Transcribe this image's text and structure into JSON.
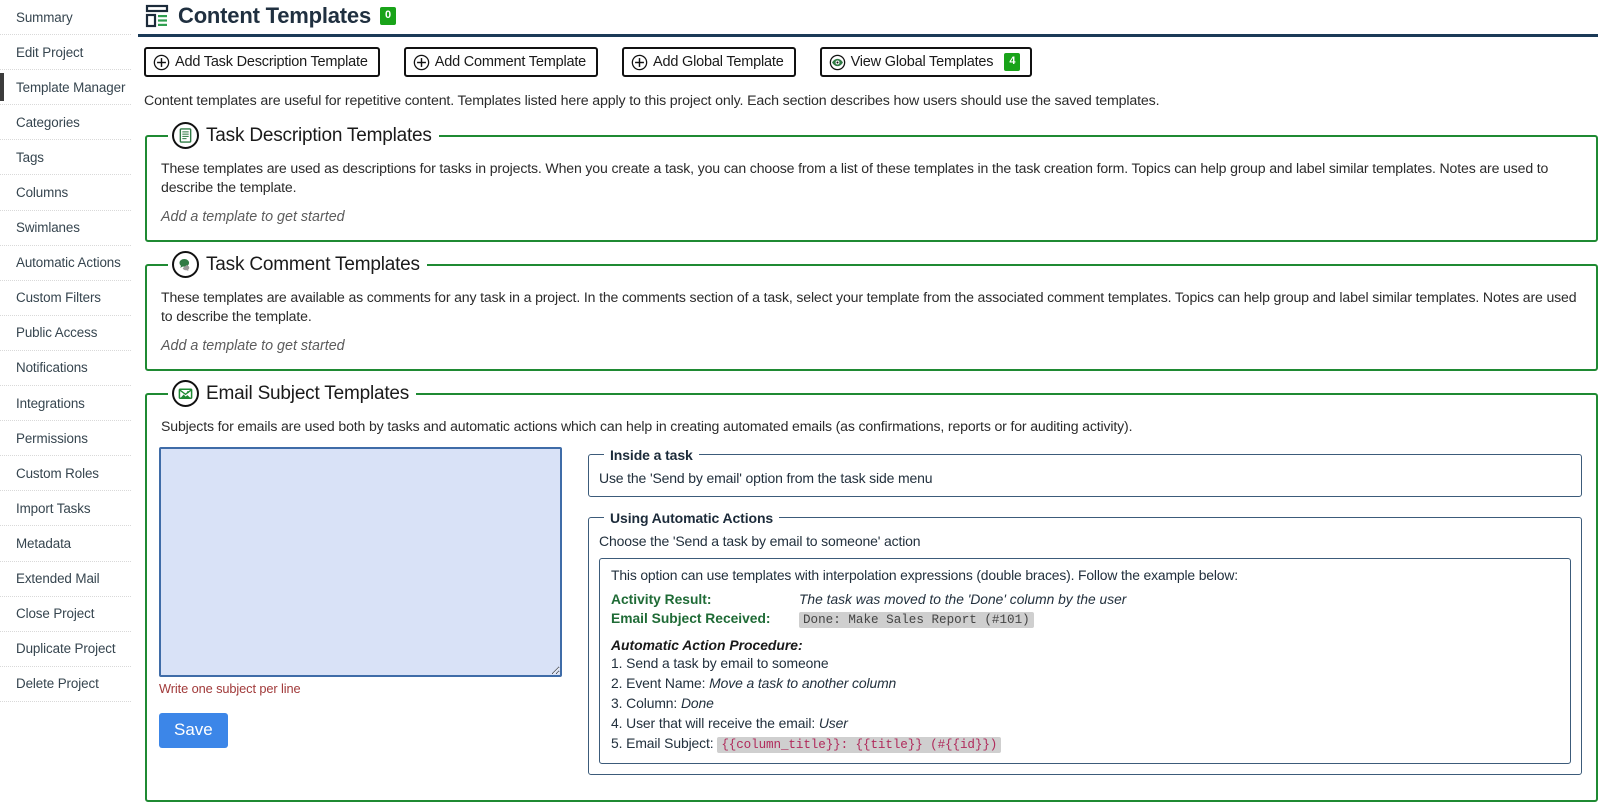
{
  "sidebar": {
    "items": [
      {
        "label": "Summary",
        "active": false
      },
      {
        "label": "Edit Project",
        "active": false
      },
      {
        "label": "Template Manager",
        "active": true
      },
      {
        "label": "Categories",
        "active": false
      },
      {
        "label": "Tags",
        "active": false
      },
      {
        "label": "Columns",
        "active": false
      },
      {
        "label": "Swimlanes",
        "active": false
      },
      {
        "label": "Automatic Actions",
        "active": false
      },
      {
        "label": "Custom Filters",
        "active": false
      },
      {
        "label": "Public Access",
        "active": false
      },
      {
        "label": "Notifications",
        "active": false
      },
      {
        "label": "Integrations",
        "active": false
      },
      {
        "label": "Permissions",
        "active": false
      },
      {
        "label": "Custom Roles",
        "active": false
      },
      {
        "label": "Import Tasks",
        "active": false
      },
      {
        "label": "Metadata",
        "active": false
      },
      {
        "label": "Extended Mail",
        "active": false
      },
      {
        "label": "Close Project",
        "active": false
      },
      {
        "label": "Duplicate Project",
        "active": false
      },
      {
        "label": "Delete Project",
        "active": false
      }
    ]
  },
  "header": {
    "title": "Content Templates",
    "badge": "0",
    "icon": "content-templates-icon",
    "accent_color": "#1b3a57",
    "badge_color": "#19a319"
  },
  "toolbar": {
    "buttons": [
      {
        "label": "Add Task Description Template",
        "icon": "plus-circle-icon",
        "badge": null
      },
      {
        "label": "Add Comment Template",
        "icon": "plus-circle-icon",
        "badge": null
      },
      {
        "label": "Add Global Template",
        "icon": "plus-circle-icon",
        "badge": null
      },
      {
        "label": "View Global Templates",
        "icon": "eye-circle-icon",
        "badge": "4"
      }
    ]
  },
  "intro": "Content templates are useful for repetitive content. Templates listed here apply to this project only. Each section describes how users should use the saved templates.",
  "sections": {
    "task_description": {
      "legend": "Task Description Templates",
      "icon": "document-icon",
      "description": "These templates are used as descriptions for tasks in projects. When you create a task, you can choose from a list of these templates in the task creation form. Topics can help group and label similar templates. Notes are used to describe the template.",
      "empty": "Add a template to get started"
    },
    "task_comment": {
      "legend": "Task Comment Templates",
      "icon": "comment-icon",
      "description": "These templates are available as comments for any task in a project. In the comments section of a task, select your template from the associated comment templates. Topics can help group and label similar templates. Notes are used to describe the template.",
      "empty": "Add a template to get started"
    },
    "email_subject": {
      "legend": "Email Subject Templates",
      "icon": "email-image-icon",
      "description": "Subjects for emails are used both by tasks and automatic actions which can help in creating automated emails (as confirmations, reports or for auditing activity).",
      "textarea_value": "",
      "textarea_placeholder": "",
      "hint": "Write one subject per line",
      "save_label": "Save",
      "inside_task": {
        "legend": "Inside a task",
        "line": "Use the 'Send by email' option from the task side menu"
      },
      "automatic_actions": {
        "legend": "Using Automatic Actions",
        "line": "Choose the 'Send a task by email to someone' action",
        "example": {
          "lead": "This option can use templates with interpolation expressions (double braces). Follow the example below:",
          "activity_result_label": "Activity Result:",
          "activity_result_value": "The task was moved to the 'Done' column by the user",
          "email_subject_label": "Email Subject Received:",
          "email_subject_value": "Done: Make Sales Report (#101)",
          "procedure_title": "Automatic Action Procedure:",
          "procedure": [
            {
              "num": "1.",
              "text": "Send a task by email to someone",
              "em": "",
              "code": ""
            },
            {
              "num": "2.",
              "text": "Event Name:",
              "em": "Move a task to another column",
              "code": ""
            },
            {
              "num": "3.",
              "text": "Column:",
              "em": "Done",
              "code": ""
            },
            {
              "num": "4.",
              "text": "User that will receive the email:",
              "em": "User",
              "code": ""
            },
            {
              "num": "5.",
              "text": "Email Subject:",
              "em": "",
              "code": "{{column_title}}: {{title}} (#{{id}})"
            }
          ]
        }
      }
    }
  }
}
